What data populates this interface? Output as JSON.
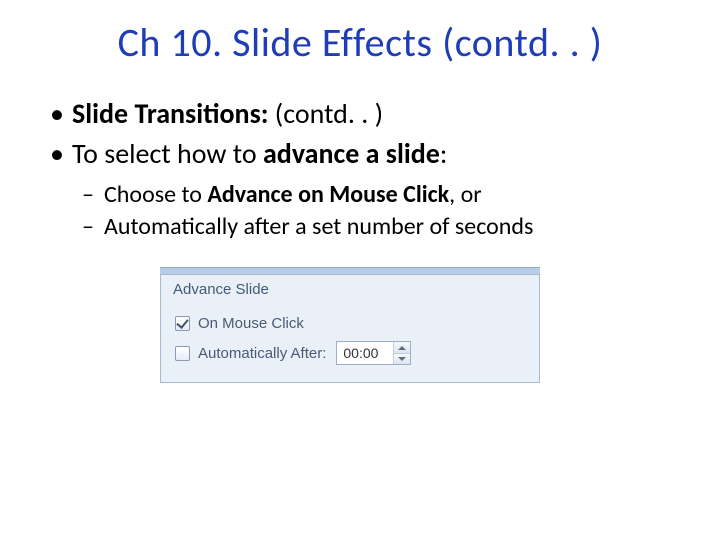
{
  "title": "Ch 10. Slide Effects (contd. . )",
  "bullets": {
    "b1_bold": "Slide Transitions: ",
    "b1_rest": "(contd. . )",
    "b2_pre": "To select how to ",
    "b2_bold": "advance a slide",
    "b2_post": ":",
    "sub1_pre": "Choose to ",
    "sub1_bold": "Advance on Mouse Click",
    "sub1_post": ", or",
    "sub2": "Automatically after a set number of seconds"
  },
  "panel": {
    "header": "Advance Slide",
    "opt_mouse": "On Mouse Click",
    "opt_auto": "Automatically After:",
    "time_value": "00:00"
  }
}
